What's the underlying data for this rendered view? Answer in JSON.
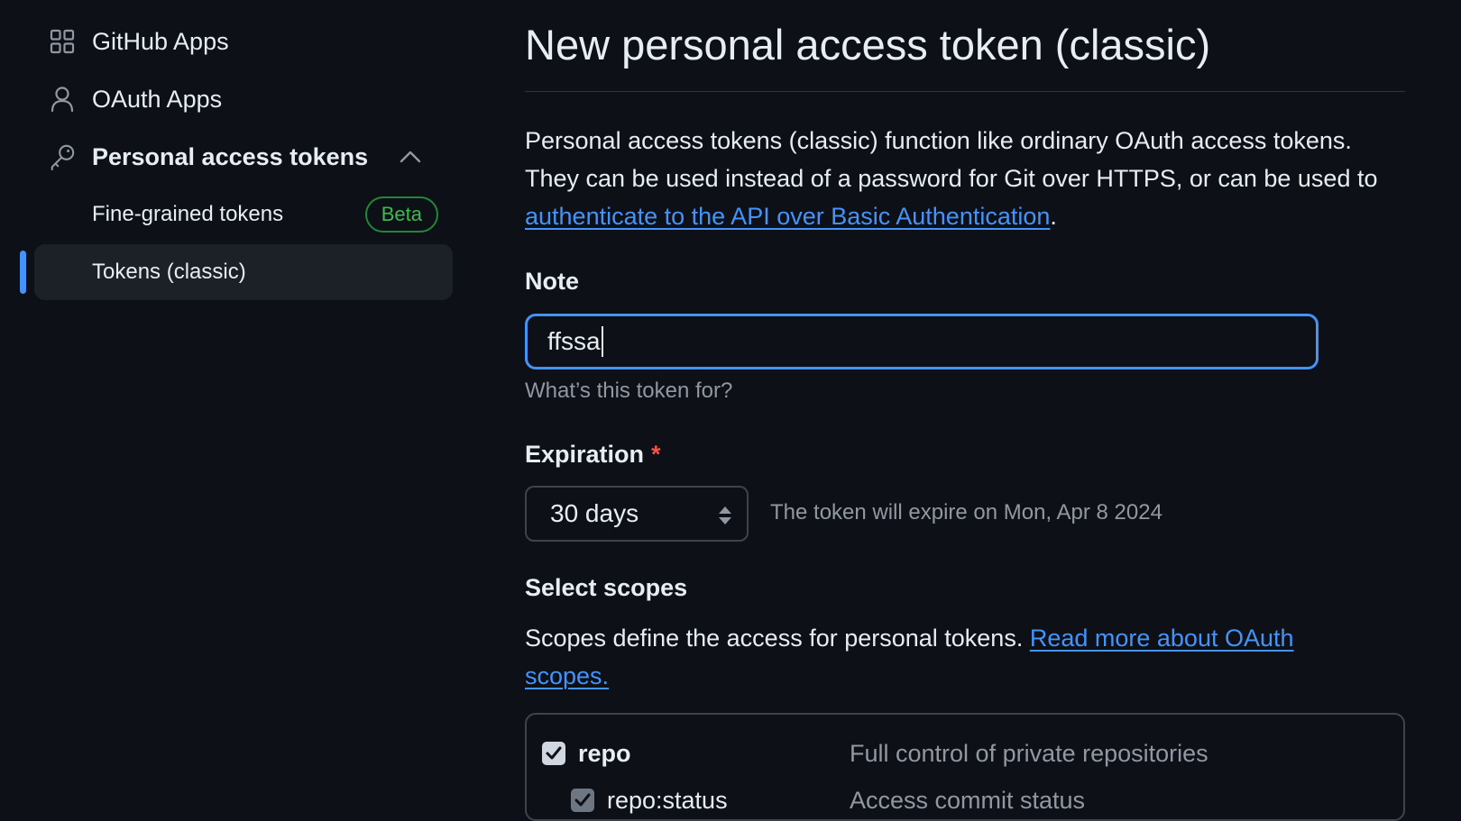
{
  "sidebar": {
    "items": [
      {
        "label": "GitHub Apps",
        "icon": "apps-grid-icon"
      },
      {
        "label": "OAuth Apps",
        "icon": "person-icon"
      },
      {
        "label": "Personal access tokens",
        "icon": "key-icon",
        "expanded": true
      }
    ],
    "sub_items": [
      {
        "label": "Fine-grained tokens",
        "badge": "Beta"
      },
      {
        "label": "Tokens (classic)",
        "active": true
      }
    ]
  },
  "main": {
    "title": "New personal access token (classic)",
    "intro_text": "Personal access tokens (classic) function like ordinary OAuth access tokens. They can be used instead of a password for Git over HTTPS, or can be used to ",
    "intro_link": "authenticate to the API over Basic Authentication",
    "intro_end": ".",
    "note": {
      "label": "Note",
      "value": "ffssa",
      "hint": "What’s this token for?"
    },
    "expiration": {
      "label": "Expiration",
      "required_mark": "*",
      "selected": "30 days",
      "note": "The token will expire on Mon, Apr 8 2024"
    },
    "scopes": {
      "heading": "Select scopes",
      "description": "Scopes define the access for personal tokens. ",
      "link": "Read more about OAuth scopes.",
      "items": [
        {
          "name": "repo",
          "description": "Full control of private repositories",
          "checked": true
        },
        {
          "name": "repo:status",
          "description": "Access commit status",
          "checked": true
        }
      ]
    }
  },
  "colors": {
    "background": "#0d1117",
    "accent": "#4493f8",
    "badge_green": "#3fb950",
    "required_red": "#f85149",
    "muted_text": "#9198a1"
  }
}
